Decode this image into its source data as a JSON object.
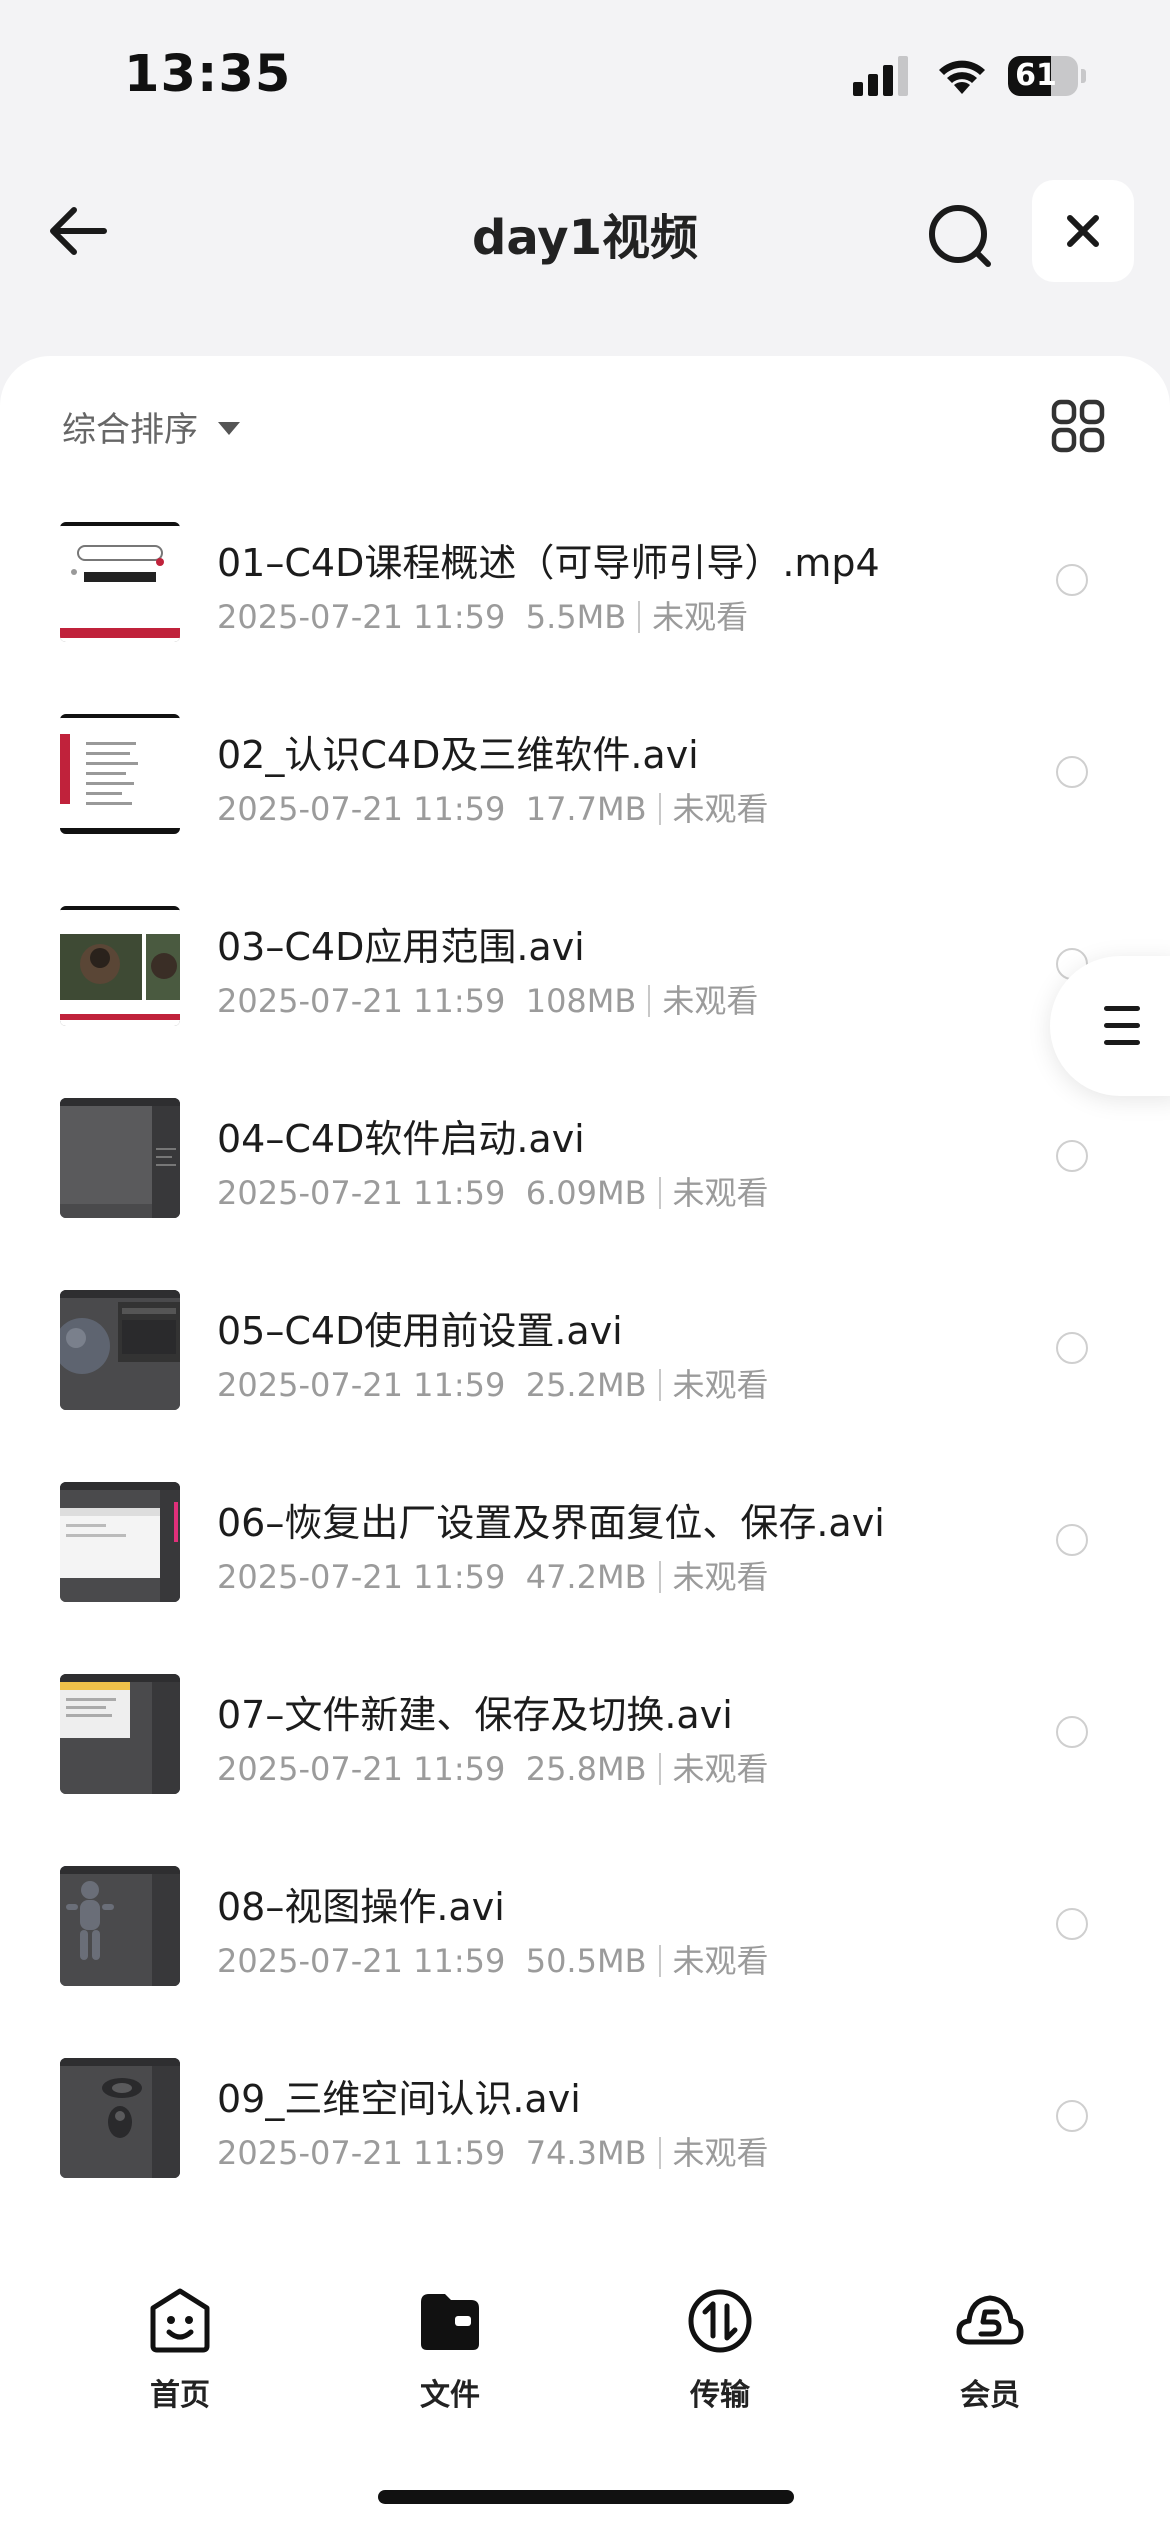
{
  "status_bar": {
    "time": "13:35",
    "battery": "61",
    "battery_fraction": 0.61
  },
  "header": {
    "title": "day1视频"
  },
  "toolbar": {
    "sort_label": "综合排序"
  },
  "files": [
    {
      "name": "01–C4D课程概述（可导师引导）.mp4",
      "date": "2025-07-21 11:59",
      "size": "5.5MB",
      "status": "未观看",
      "thumb": "title-slide"
    },
    {
      "name": "02_认识C4D及三维软件.avi",
      "date": "2025-07-21 11:59",
      "size": "17.7MB",
      "status": "未观看",
      "thumb": "contents-slide"
    },
    {
      "name": "03–C4D应用范围.avi",
      "date": "2025-07-21 11:59",
      "size": "108MB",
      "status": "未观看",
      "thumb": "photo-slide"
    },
    {
      "name": "04–C4D软件启动.avi",
      "date": "2025-07-21 11:59",
      "size": "6.09MB",
      "status": "未观看",
      "thumb": "c4d-ui"
    },
    {
      "name": "05–C4D使用前设置.avi",
      "date": "2025-07-21 11:59",
      "size": "25.2MB",
      "status": "未观看",
      "thumb": "c4d-sphere"
    },
    {
      "name": "06–恢复出厂设置及界面复位、保存.avi",
      "date": "2025-07-21 11:59",
      "size": "47.2MB",
      "status": "未观看",
      "thumb": "c4d-dialog"
    },
    {
      "name": "07–文件新建、保存及切换.avi",
      "date": "2025-07-21 11:59",
      "size": "25.8MB",
      "status": "未观看",
      "thumb": "c4d-file"
    },
    {
      "name": "08–视图操作.avi",
      "date": "2025-07-21 11:59",
      "size": "50.5MB",
      "status": "未观看",
      "thumb": "c4d-figure"
    },
    {
      "name": "09_三维空间认识.avi",
      "date": "2025-07-21 11:59",
      "size": "74.3MB",
      "status": "未观看",
      "thumb": "c4d-model"
    }
  ],
  "tabs": [
    {
      "label": "首页",
      "icon": "smile-icon"
    },
    {
      "label": "文件",
      "icon": "folder-icon"
    },
    {
      "label": "传输",
      "icon": "transfer-icon"
    },
    {
      "label": "会员",
      "icon": "cloud-s-icon"
    }
  ]
}
